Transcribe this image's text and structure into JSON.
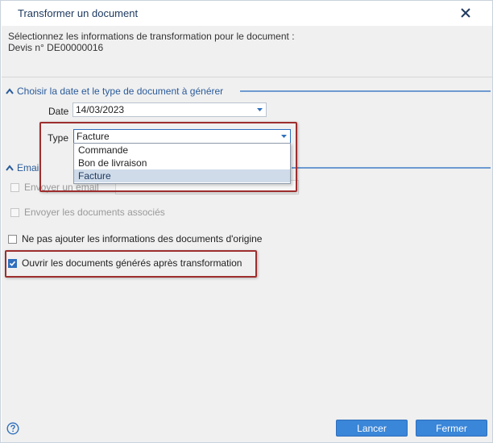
{
  "dialog": {
    "title": "Transformer un document",
    "close_icon": "close-icon"
  },
  "intro": {
    "line1": "Sélectionnez les informations de transformation pour le document :",
    "line2": "Devis n° DE00000016"
  },
  "section_date_type": {
    "title": "Choisir la date et le type de document à générer",
    "date_label": "Date",
    "date_value": "14/03/2023",
    "type_label": "Type",
    "type_value": "Facture",
    "type_options": [
      "Commande",
      "Bon de livraison",
      "Facture"
    ],
    "selected_option": "Facture"
  },
  "section_email": {
    "title": "Email",
    "send_email_label": "Envoyer un email",
    "send_associated_label": "Envoyer les documents associés"
  },
  "options": {
    "no_origin_info_label": "Ne pas ajouter les informations des documents d'origine",
    "open_generated_label": "Ouvrir les documents générés après transformation"
  },
  "footer": {
    "cancel_label": "Lancer",
    "close_label": "Fermer",
    "help_icon": "help-icon"
  },
  "colors": {
    "accent": "#2f6fbd",
    "button": "#3a86d8",
    "highlight": "#9e2e2e",
    "section_text": "#2a5b9a"
  }
}
